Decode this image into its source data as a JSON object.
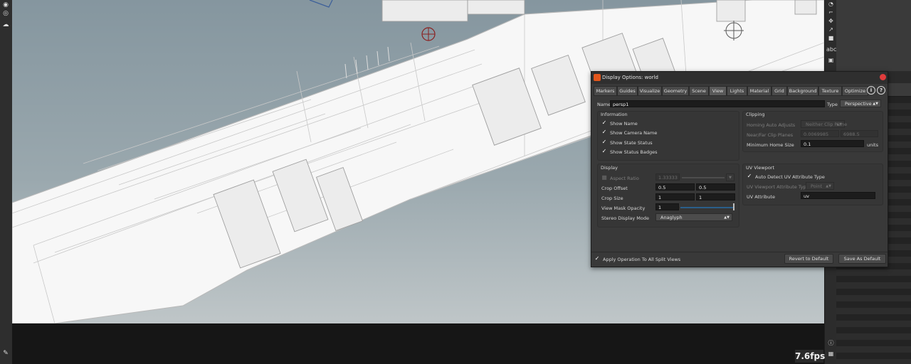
{
  "viewport": {
    "fps": "7.6fps"
  },
  "dialog": {
    "title": "Display Options: world",
    "tabs": [
      "Markers",
      "Guides",
      "Visualize",
      "Geometry",
      "Scene",
      "View",
      "Lights",
      "Material",
      "Grid",
      "Background",
      "Texture",
      "Optimize"
    ],
    "active_tab": "View",
    "info_icon": "i",
    "help_icon": "?",
    "name_label": "Name",
    "name_value": "persp1",
    "type_label": "Type",
    "type_value": "Perspective",
    "information": {
      "title": "Information",
      "items": [
        "Show Name",
        "Show Camera Name",
        "Show State Status",
        "Show Status Badges"
      ]
    },
    "clipping": {
      "title": "Clipping",
      "homing_label": "Homing Auto Adjusts",
      "homing_value": "Neither Clip Plane",
      "nearfar_label": "Near/Far Clip Planes",
      "near_value": "0.0069985",
      "far_value": "6988.5",
      "minhome_label": "Minimum Home Size",
      "minhome_value": "0.1",
      "units_label": "units"
    },
    "display": {
      "title": "Display",
      "aspect_label": "Aspect Ratio",
      "aspect_value": "1.33333",
      "crop_offset_label": "Crop Offset",
      "crop_offset_x": "0.5",
      "crop_offset_y": "0.5",
      "crop_size_label": "Crop Size",
      "crop_size_x": "1",
      "crop_size_y": "1",
      "mask_label": "View Mask Opacity",
      "mask_value": "1",
      "stereo_label": "Stereo Display Mode",
      "stereo_value": "Anaglyph"
    },
    "uv_viewport": {
      "title": "UV Viewport",
      "auto_detect_label": "Auto Detect UV Attribute Type",
      "attr_type_label": "UV Viewport Attribute Type",
      "attr_type_value": "Point",
      "attr_label": "UV Attribute",
      "attr_value": "uv"
    },
    "footer": {
      "apply_label": "Apply Operation To All Split Views",
      "revert_label": "Revert to Default",
      "save_label": "Save As Default"
    }
  },
  "right_toolbar": {
    "text_tool": "abc"
  }
}
